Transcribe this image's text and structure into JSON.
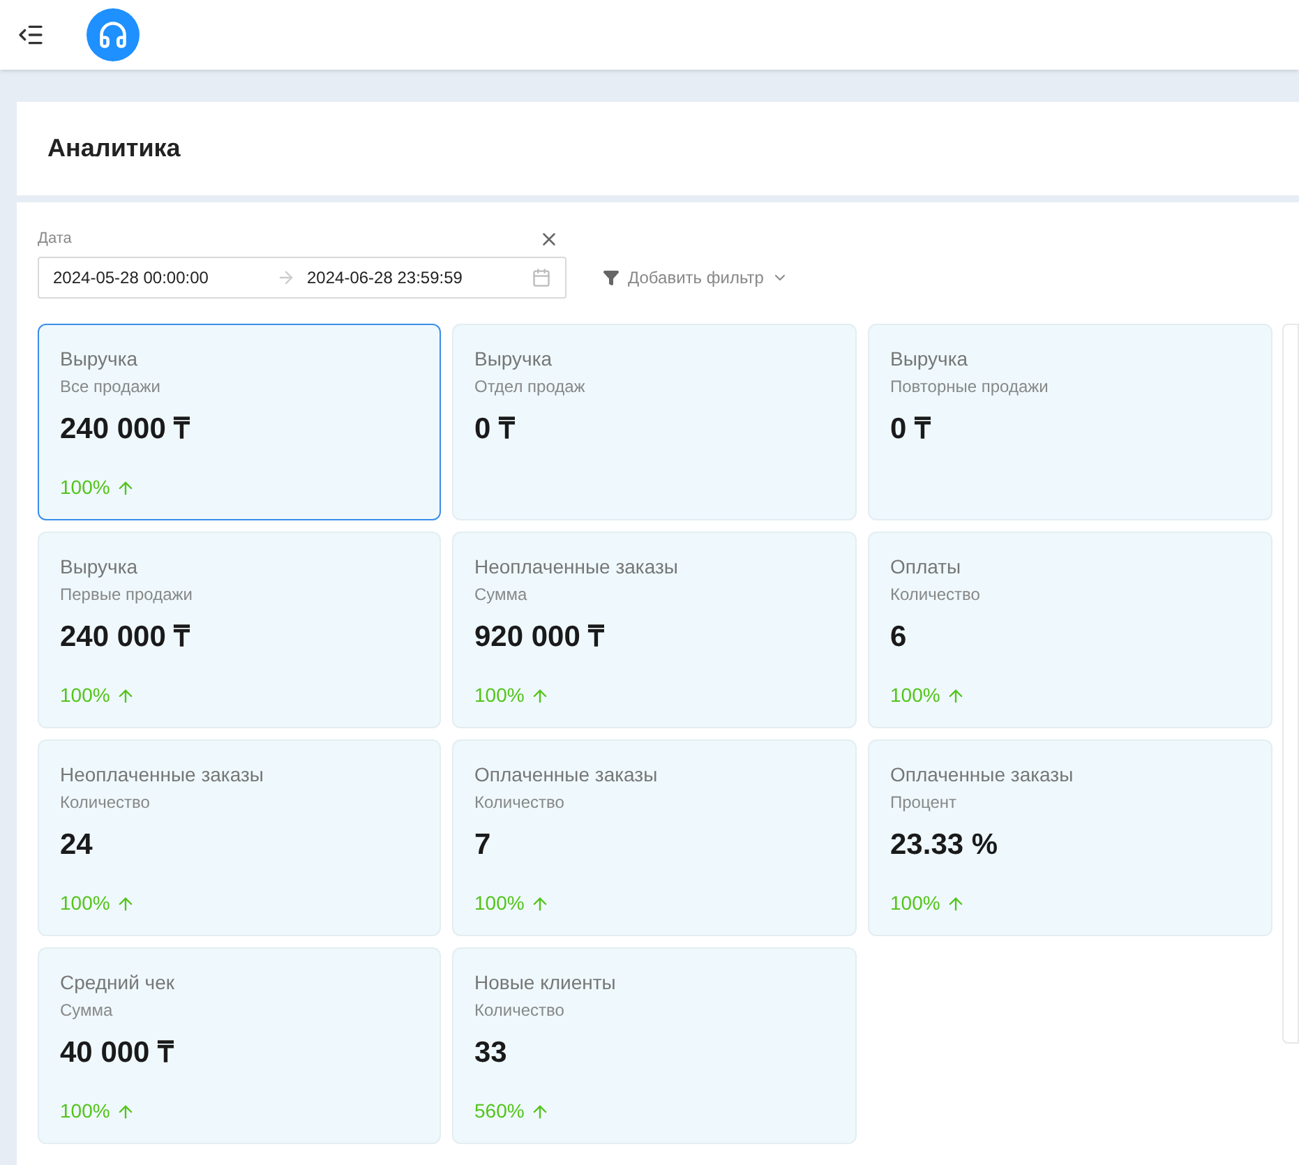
{
  "page": {
    "title": "Аналитика"
  },
  "filters": {
    "date_label": "Дата",
    "date_from": "2024-05-28 00:00:00",
    "date_to": "2024-06-28 23:59:59",
    "add_filter": "Добавить фильтр"
  },
  "cards": [
    {
      "title": "Выручка",
      "subtitle": "Все продажи",
      "value": "240 000 ₸",
      "change": "100%",
      "selected": true
    },
    {
      "title": "Выручка",
      "subtitle": "Отдел продаж",
      "value": "0 ₸",
      "selected": false
    },
    {
      "title": "Выручка",
      "subtitle": "Повторные продажи",
      "value": "0 ₸",
      "selected": false
    },
    {
      "title": "Выручка",
      "subtitle": "Первые продажи",
      "value": "240 000 ₸",
      "change": "100%",
      "selected": false
    },
    {
      "title": "Неоплаченные заказы",
      "subtitle": "Сумма",
      "value": "920 000 ₸",
      "change": "100%",
      "selected": false
    },
    {
      "title": "Оплаты",
      "subtitle": "Количество",
      "value": "6",
      "change": "100%",
      "selected": false
    },
    {
      "title": "Неоплаченные заказы",
      "subtitle": "Количество",
      "value": "24",
      "change": "100%",
      "selected": false
    },
    {
      "title": "Оплаченные заказы",
      "subtitle": "Количество",
      "value": "7",
      "change": "100%",
      "selected": false
    },
    {
      "title": "Оплаченные заказы",
      "subtitle": "Процент",
      "value": "23.33 %",
      "change": "100%",
      "selected": false
    },
    {
      "title": "Средний чек",
      "subtitle": "Сумма",
      "value": "40 000 ₸",
      "change": "100%",
      "selected": false
    },
    {
      "title": "Новые клиенты",
      "subtitle": "Количество",
      "value": "33",
      "change": "560%",
      "selected": false
    }
  ]
}
